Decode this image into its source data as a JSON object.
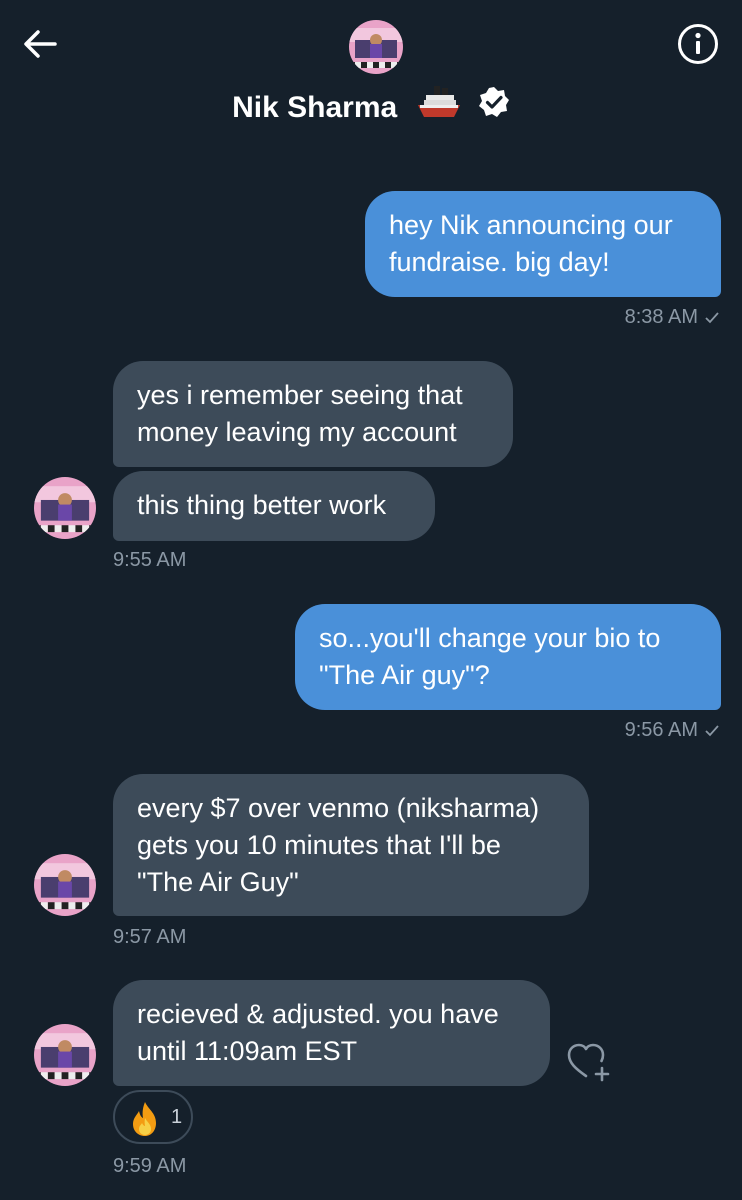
{
  "header": {
    "name": "Nik Sharma",
    "back_icon": "arrow-left-icon",
    "info_icon": "info-icon",
    "verified_icon": "verified-badge-icon",
    "name_emoji_icon": "ship-icon"
  },
  "messages": [
    {
      "direction": "out",
      "text": "hey Nik announcing our\nfundraise. big day!",
      "time": "8:38 AM",
      "read": true
    },
    {
      "direction": "in",
      "text": "yes i remember seeing that\nmoney leaving my account"
    },
    {
      "direction": "in",
      "text": "this thing better work",
      "time": "9:55 AM"
    },
    {
      "direction": "out",
      "text": "so...you'll change your bio to\n\"The Air guy\"?",
      "time": "9:56 AM",
      "read": true
    },
    {
      "direction": "in",
      "text": "every $7 over venmo (niksharma)\ngets you 10 minutes that I'll be\n\"The Air Guy\"",
      "time": "9:57 AM"
    },
    {
      "direction": "in",
      "text": "recieved & adjusted. you have\nuntil 11:09am EST",
      "time": "9:59 AM",
      "reaction": {
        "emoji": "fire-icon",
        "count": "1"
      }
    }
  ],
  "colors": {
    "background": "#15202b",
    "outgoing_bubble": "#4a90d9",
    "incoming_bubble": "#3d4b59",
    "timestamp": "#8b98a5"
  }
}
